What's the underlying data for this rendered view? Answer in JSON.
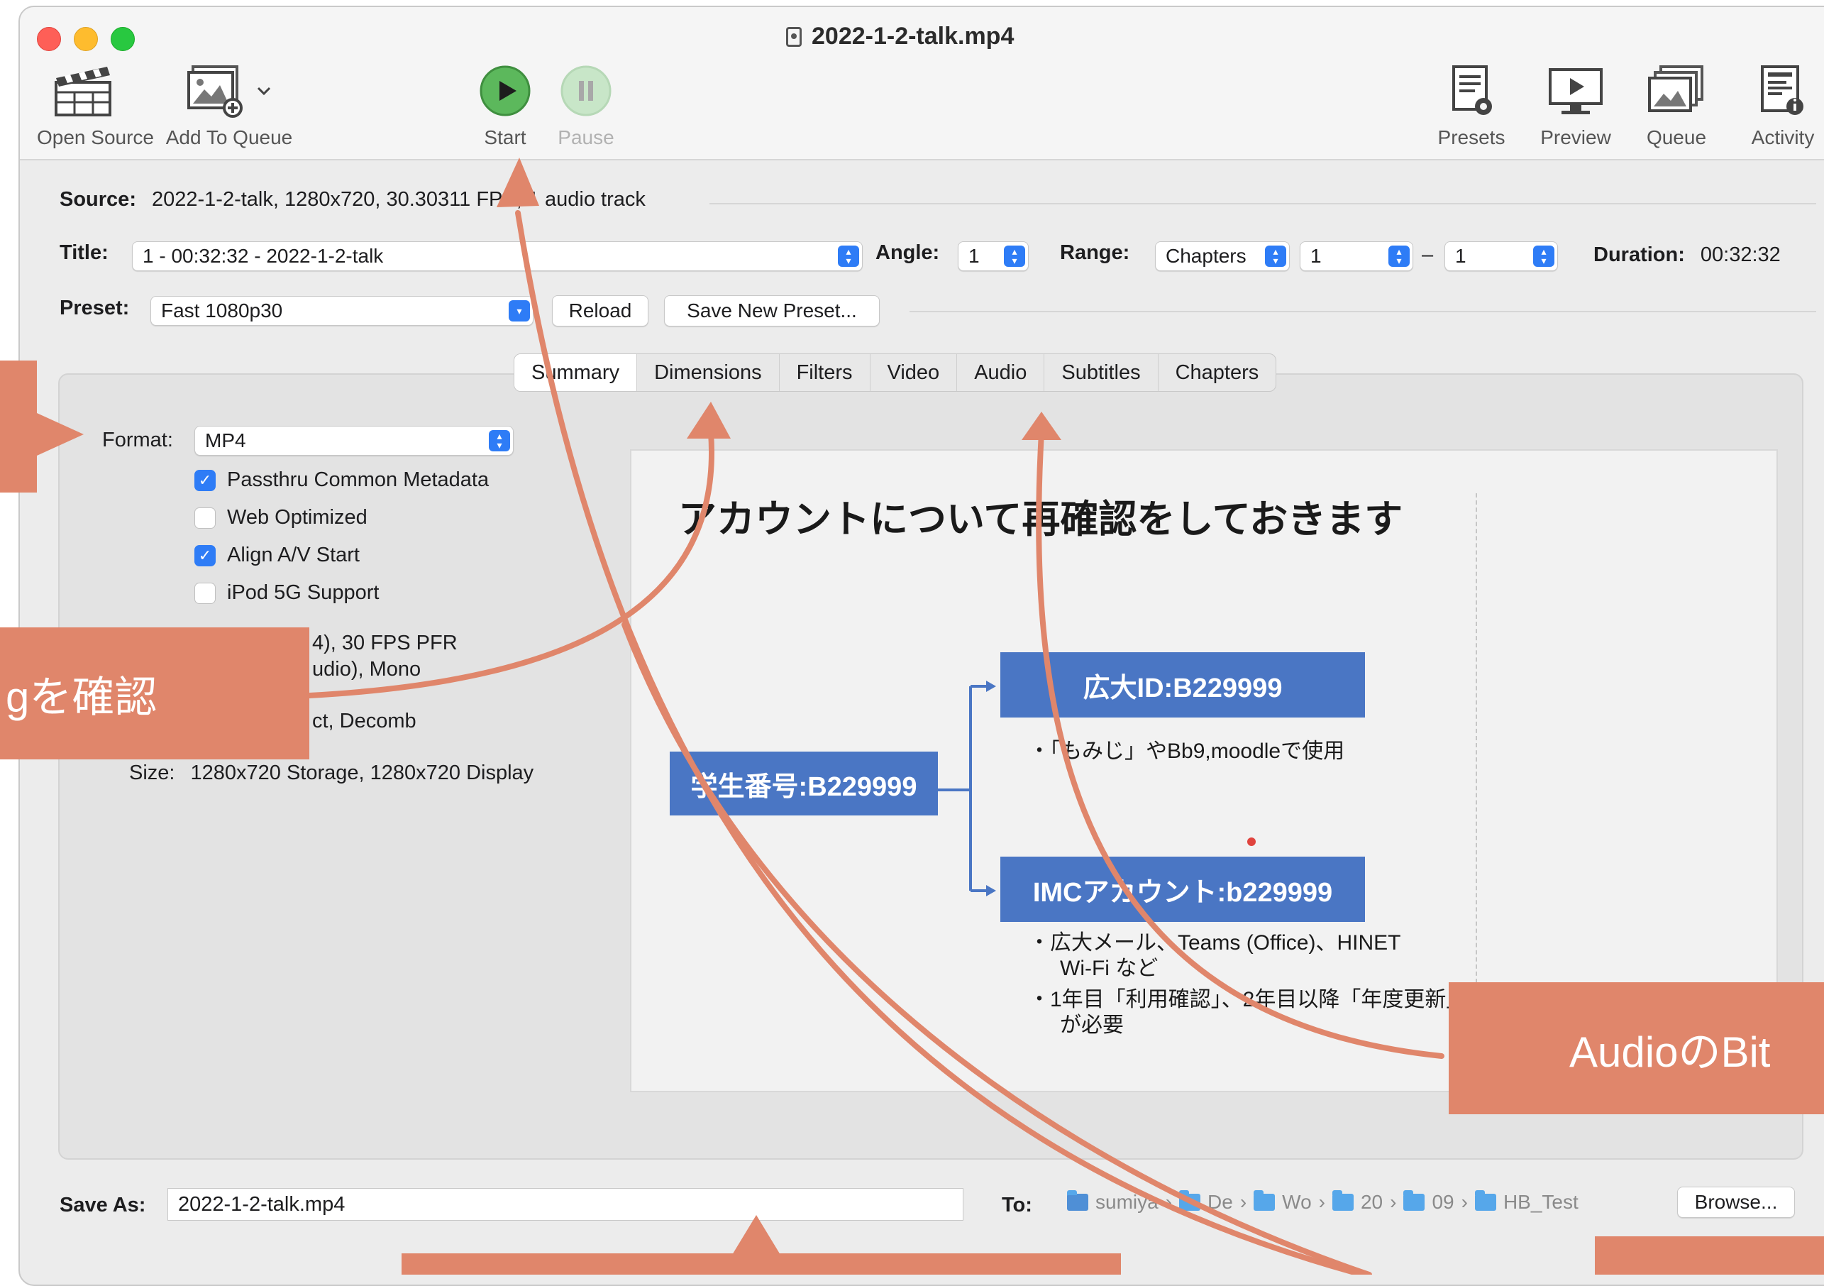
{
  "window": {
    "title": "2022-1-2-talk.mp4"
  },
  "toolbar": {
    "open_source": "Open Source",
    "add_to_queue": "Add To Queue",
    "start": "Start",
    "pause": "Pause",
    "presets": "Presets",
    "preview": "Preview",
    "queue": "Queue",
    "activity": "Activity"
  },
  "source": {
    "label": "Source:",
    "value": "2022-1-2-talk, 1280x720, 30.30311 FPS, 1 audio track"
  },
  "title_row": {
    "label": "Title:",
    "value": "1 - 00:32:32 - 2022-1-2-talk",
    "angle_label": "Angle:",
    "angle_value": "1",
    "range_label": "Range:",
    "range_type": "Chapters",
    "range_start": "1",
    "range_dash": "–",
    "range_end": "1",
    "duration_label": "Duration:",
    "duration_value": "00:32:32"
  },
  "preset_row": {
    "label": "Preset:",
    "value": "Fast 1080p30",
    "reload": "Reload",
    "save_new": "Save New Preset..."
  },
  "tabs": [
    "Summary",
    "Dimensions",
    "Filters",
    "Video",
    "Audio",
    "Subtitles",
    "Chapters"
  ],
  "summary": {
    "format_label": "Format:",
    "format_value": "MP4",
    "checkboxes": [
      {
        "label": "Passthru Common Metadata",
        "checked": true
      },
      {
        "label": "Web Optimized",
        "checked": false
      },
      {
        "label": "Align A/V Start",
        "checked": true
      },
      {
        "label": "iPod 5G Support",
        "checked": false
      }
    ],
    "track_line_1": "4), 30 FPS PFR",
    "track_line_2": "udio), Mono",
    "filters_line": "ct, Decomb",
    "size_label": "Size:",
    "size_value": "1280x720 Storage, 1280x720 Display"
  },
  "slide": {
    "title": "アカウントについて再確認をしておきます",
    "student_box": "学生番号:B229999",
    "id_box": "広大ID:B229999",
    "id_bullet": "・「もみじ」やBb9,moodleで使用",
    "imc_box": "IMCアカウント:b229999",
    "imc_bullet_1a": "・広大メール、Teams (Office)、HINET",
    "imc_bullet_1b": "Wi-Fi など",
    "imc_bullet_2a": "・1年目「利用確認」、2年目以降「年度更新」",
    "imc_bullet_2b": "が必要"
  },
  "save": {
    "label": "Save As:",
    "value": "2022-1-2-talk.mp4",
    "to_label": "To:",
    "path": [
      "sumiya",
      "De",
      "Wo",
      "20",
      "09",
      "HB_Test"
    ],
    "browse": "Browse..."
  },
  "annotations": {
    "callout_left": "gを確認",
    "callout_right": "AudioのBit",
    "color": "#e0866b"
  }
}
